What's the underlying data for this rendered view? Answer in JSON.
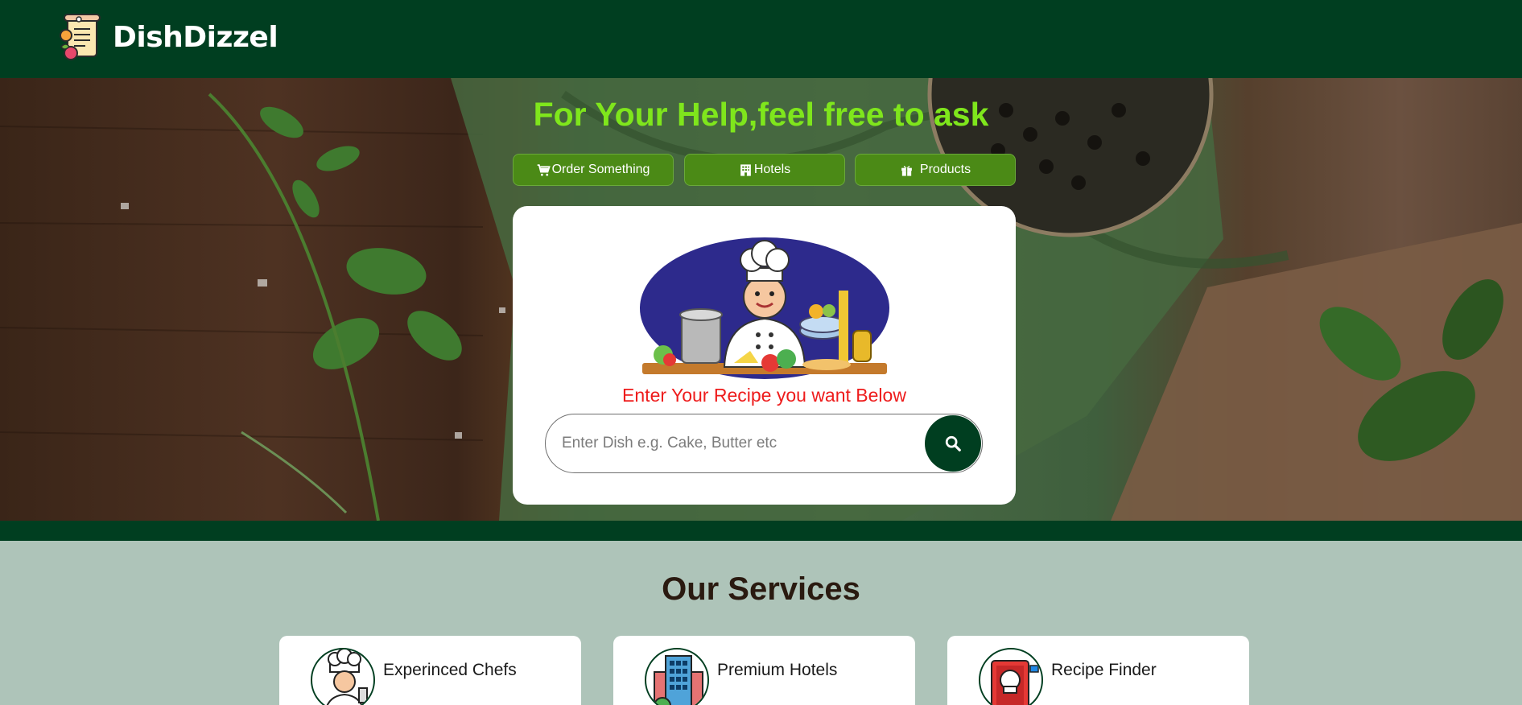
{
  "header": {
    "brand_name": "DishDizzel",
    "logo_icon": "recipe-scroll-logo"
  },
  "hero": {
    "title": "For Your Help,feel free to ask",
    "buttons": [
      {
        "label": "Order Something",
        "icon": "cart-icon"
      },
      {
        "label": "Hotels",
        "icon": "building-icon"
      },
      {
        "label": "Products",
        "icon": "gift-icon"
      }
    ],
    "card": {
      "illustration": "chef-illustration",
      "prompt": "Enter Your Recipe you want Below",
      "search": {
        "placeholder": "Enter Dish e.g. Cake, Butter etc",
        "value": ""
      }
    }
  },
  "services": {
    "title": "Our Services",
    "items": [
      {
        "label": "Experinced Chefs",
        "icon": "chef-icon"
      },
      {
        "label": "Premium Hotels",
        "icon": "hotel-building-icon"
      },
      {
        "label": "Recipe Finder",
        "icon": "recipe-book-icon"
      }
    ]
  },
  "colors": {
    "primary_dark_green": "#003e20",
    "hero_title_green": "#7fe61c",
    "pill_green": "#4b8a16",
    "prompt_red": "#ee1c1c",
    "services_bg": "#aec4b9"
  }
}
